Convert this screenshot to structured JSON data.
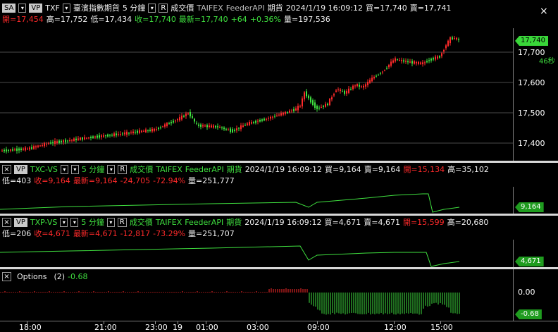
{
  "main": {
    "sa_button": "SA",
    "vp_button": "VP",
    "symbol": "TXF",
    "name": "臺濱指數期貨",
    "interval": "5 分鐘",
    "r_button": "R",
    "price_type": "成交價",
    "exchange": "TAIFEX",
    "feed": "FeederAPI",
    "market": "期貨",
    "datetime": "2024/1/19  16:09:12",
    "bid": "買=17,740",
    "ask": "賣=17,741",
    "open": "開=17,454",
    "high": "高=17,752",
    "low": "低=17,434",
    "close": "收=17,740",
    "last": "最新=17,740",
    "change": "+64",
    "change_pct": "+0.36%",
    "volume": "量=197,536",
    "close_window": "×",
    "price_axis": [
      "17,700",
      "17,600",
      "17,500",
      "17,400"
    ],
    "price_tag": "17,740",
    "countdown": "46秒"
  },
  "vs1": {
    "symbol": "TXC-VS",
    "vp_button": "VP",
    "interval": "5 分鐘",
    "r_button": "R",
    "price_type": "成交價",
    "exchange": "TAIFEX",
    "feed": "FeederAPI",
    "market": "期貨",
    "datetime": "2024/1/19  16:09:12",
    "bid": "買=9,164",
    "ask": "賣=9,164",
    "open": "開=15,134",
    "high": "高=35,102",
    "low": "低=403",
    "close": "收=9,164",
    "last": "最新=9,164",
    "change": "-24,705",
    "change_pct": "-72.94%",
    "volume": "量=251,777",
    "price_tag": "9,164"
  },
  "vs2": {
    "symbol": "TXP-VS",
    "vp_button": "VP",
    "interval": "5 分鐘",
    "r_button": "R",
    "price_type": "成交價",
    "exchange": "TAIFEX",
    "feed": "FeederAPI",
    "market": "期貨",
    "datetime": "2024/1/19  16:09:12",
    "bid": "買=4,671",
    "ask": "賣=4,671",
    "open": "開=15,599",
    "high": "高=20,680",
    "low": "低=206",
    "close": "收=4,671",
    "last": "最新=4,671",
    "change": "-12,817",
    "change_pct": "-73.29%",
    "volume": "量=251,707",
    "price_tag": "4,671"
  },
  "options": {
    "title": "Options",
    "param": "(2)",
    "value": "-0.68",
    "axis_zero": "0.00",
    "price_tag": "-0.68"
  },
  "time_axis": [
    "18:00",
    "21:00",
    "23:00",
    "19",
    "01:00",
    "03:00",
    "09:00",
    "12:00",
    "15:00"
  ],
  "colors": {
    "up": "#ff2a2a",
    "down": "#3fe03f",
    "line": "#3fe03f",
    "background": "#000000"
  }
}
